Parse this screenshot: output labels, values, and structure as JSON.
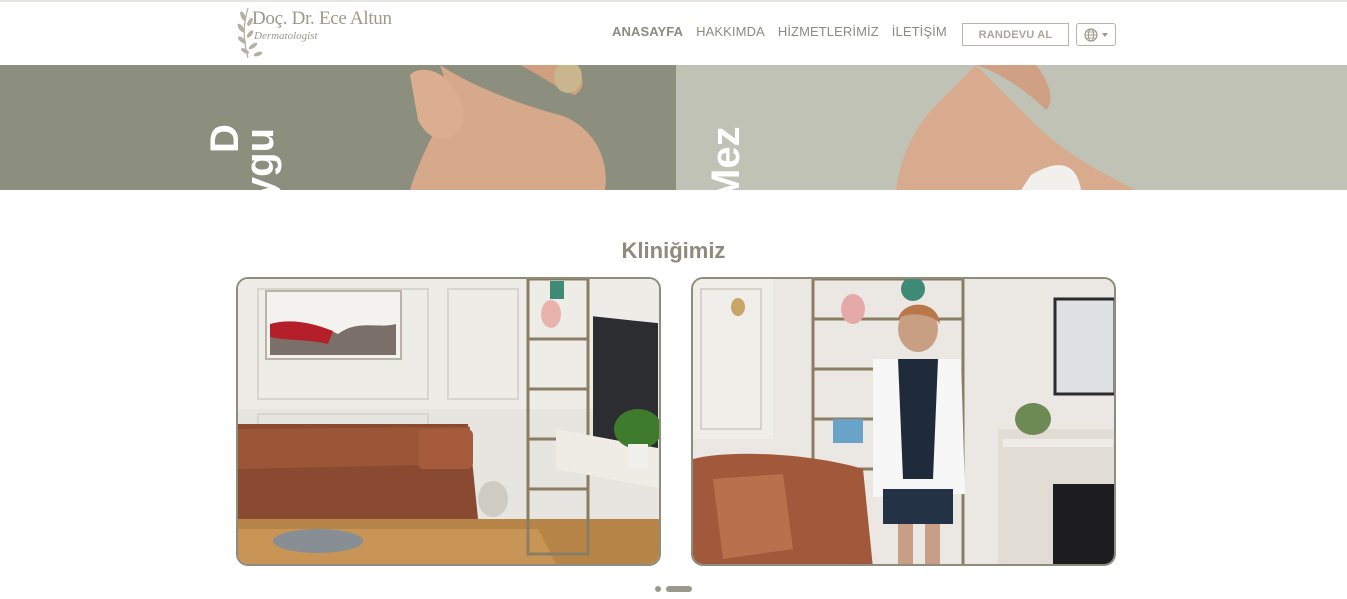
{
  "brand": {
    "name": "Doç. Dr. Ece Altun",
    "subtitle": "Dermatologist"
  },
  "nav": {
    "items": [
      {
        "label": "ANASAYFA",
        "active": true
      },
      {
        "label": "HAKKIMDA",
        "active": false
      },
      {
        "label": "HİZMETLERİMİZ",
        "active": false
      },
      {
        "label": "İLETİŞİM",
        "active": false
      }
    ],
    "cta_label": "RANDEVU AL",
    "language_icon": "globe-icon"
  },
  "banner": {
    "left_text_1": "D",
    "left_text_2": "Uygu",
    "right_text": "Mez"
  },
  "clinic": {
    "title": "Kliniğimiz",
    "slides_total": 2,
    "active_slide": 2
  },
  "colors": {
    "accent": "#8c8b80",
    "banner_left": "#8c8e7e",
    "banner_right": "#bfc2b4"
  }
}
